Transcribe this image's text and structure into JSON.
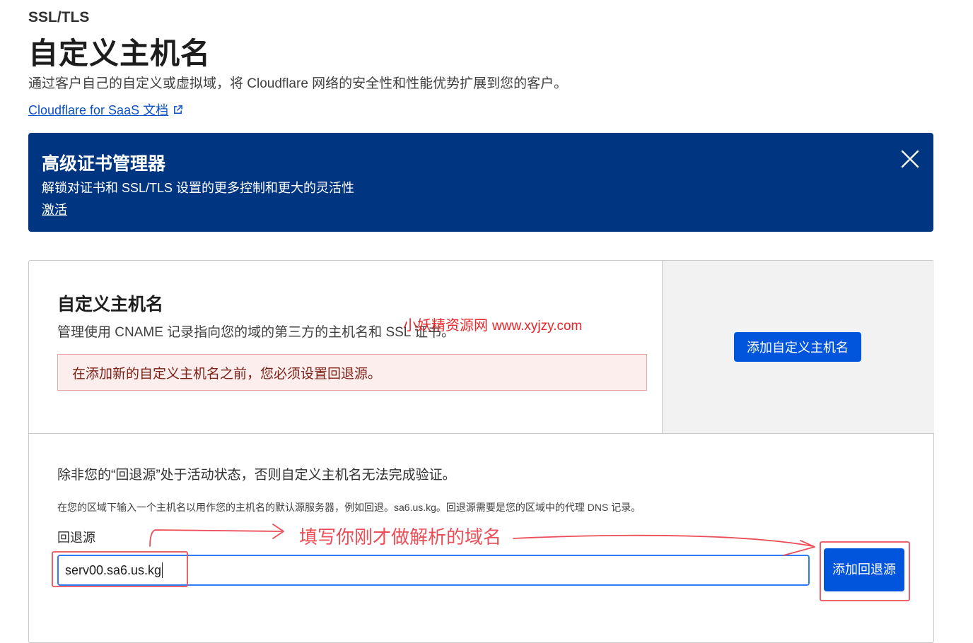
{
  "header": {
    "section": "SSL/TLS",
    "title": "自定义主机名",
    "description": "通过客户自己的自定义或虚拟域，将 Cloudflare 网络的安全性和性能优势扩展到您的客户。",
    "doc_link": "Cloudflare for SaaS 文档"
  },
  "banner": {
    "title": "高级证书管理器",
    "description": "解锁对证书和 SSL/TLS 设置的更多控制和更大的灵活性",
    "link": "激活"
  },
  "custom_hostnames": {
    "title": "自定义主机名",
    "description": "管理使用 CNAME 记录指向您的域的第三方的主机名和 SSL 证书。",
    "alert": "在添加新的自定义主机名之前，您必须设置回退源。",
    "add_button": "添加自定义主机名"
  },
  "fallback": {
    "notice": "除非您的“回退源”处于活动状态，否则自定义主机名无法完成验证。",
    "hint": "在您的区域下输入一个主机名以用作您的主机名的默认源服务器，例如回退。sa6.us.kg。回退源需要是您的区域中的代理 DNS 记录。",
    "label": "回退源",
    "input_value": "serv00.sa6.us.kg",
    "add_button": "添加回退源"
  },
  "overlay": {
    "watermark_name": "小妖精资源网",
    "watermark_site": "www.xyjzy.com",
    "annotation": "填写你刚才做解析的域名"
  },
  "colors": {
    "banner_bg": "#003681",
    "primary_button": "#0055dc",
    "link": "#0b50c5",
    "annotation": "#ec4e58"
  }
}
